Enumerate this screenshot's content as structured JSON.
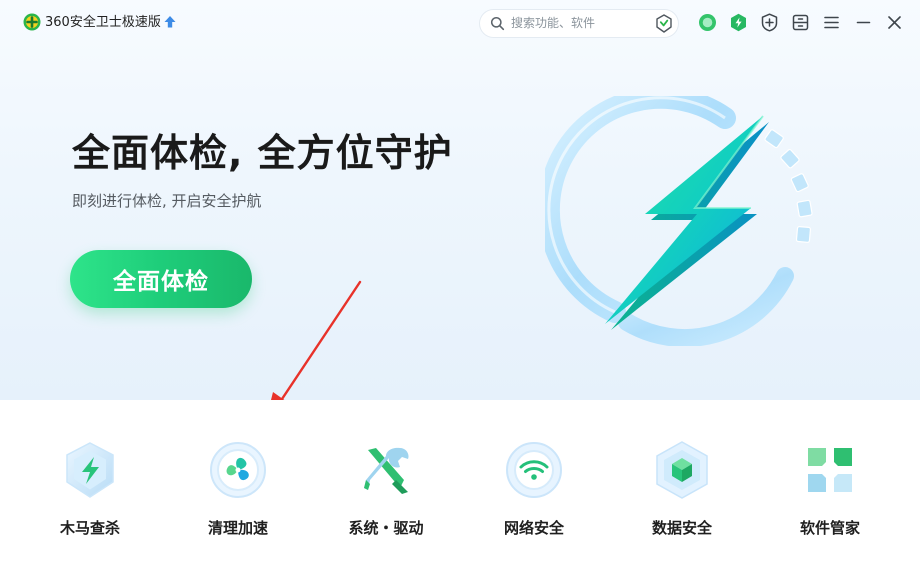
{
  "window": {
    "title": "360安全卫士极速版",
    "icons": {
      "logo": "360-logo-icon",
      "upgrade": "upgrade-arrow-icon",
      "minimize": "minimize-icon",
      "close": "close-icon"
    }
  },
  "search": {
    "placeholder": "搜索功能、软件",
    "icon": "search-icon",
    "trailing_icon": "shield-check-icon"
  },
  "toolbar": {
    "icons": [
      "green-circle-icon",
      "hexagon-shield-icon",
      "shield-plus-icon",
      "cabinet-icon",
      "menu-icon"
    ]
  },
  "hero": {
    "headline": "全面体检, 全方位守护",
    "subline": "即刻进行体检, 开启安全护航",
    "button_label": "全面体检",
    "emblem": "lightning-ring-icon"
  },
  "functions": [
    {
      "label": "木马查杀",
      "icon": "trojan-shield-icon"
    },
    {
      "label": "清理加速",
      "icon": "fan-clean-icon"
    },
    {
      "label": "系统・驱动",
      "icon": "tools-icon"
    },
    {
      "label": "网络安全",
      "icon": "wifi-icon"
    },
    {
      "label": "数据安全",
      "icon": "data-cube-icon"
    },
    {
      "label": "软件管家",
      "icon": "software-grid-icon"
    }
  ],
  "colors": {
    "accent_green": "#1ecd7a",
    "annotation_red": "#e8322a",
    "brand_blue": "#3d8be6"
  }
}
